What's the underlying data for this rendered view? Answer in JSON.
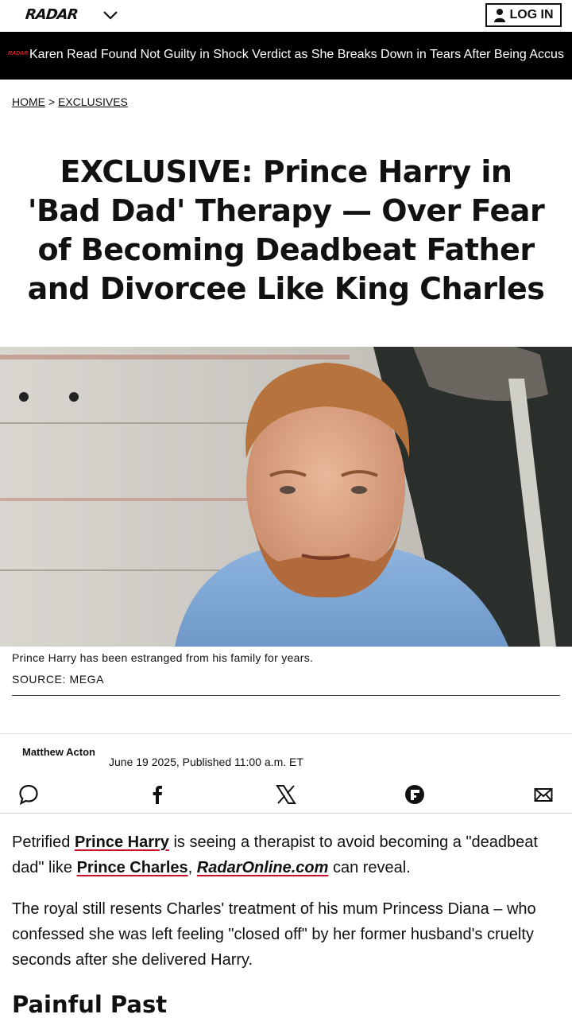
{
  "header": {
    "logo": "RADAR",
    "login_label": "LOG IN"
  },
  "ticker": {
    "logo": "RADAR",
    "headline": "Karen Read Found Not Guilty in Shock Verdict as She Breaks Down in Tears After Being Accus"
  },
  "breadcrumb": {
    "home": "HOME",
    "separator": ">",
    "section": "EXCLUSIVES"
  },
  "article": {
    "title": "EXCLUSIVE: Prince Harry in 'Bad Dad' Therapy — Over Fear of Becoming Deadbeat Father and Divorcee Like King Charles",
    "caption": "Prince Harry has been estranged from his family for years.",
    "source": "SOURCE: MEGA",
    "author": "Matthew Acton",
    "date": "June 19 2025, Published 11:00 a.m. ET",
    "p1": {
      "t1": "Petrified ",
      "l1": "Prince Harry",
      "t2": " is seeing a therapist to avoid becoming a \"deadbeat dad\" like ",
      "l2": "Prince Charles",
      "t3": ", ",
      "l3": "RadarOnline.com",
      "t4": " can reveal."
    },
    "p2": "The royal still resents Charles' treatment of his mum Princess Diana – who confessed she was left feeling \"closed off\" by her former husband's cruelty seconds after she delivered Harry.",
    "subheading": "Painful Past"
  },
  "share": {
    "icons": [
      "comment-icon",
      "facebook-icon",
      "x-icon",
      "flipboard-icon",
      "email-icon"
    ]
  },
  "colors": {
    "ticker_bg": "#000000",
    "link_underline": "#c8102e",
    "brand_red": "#d0232a"
  }
}
